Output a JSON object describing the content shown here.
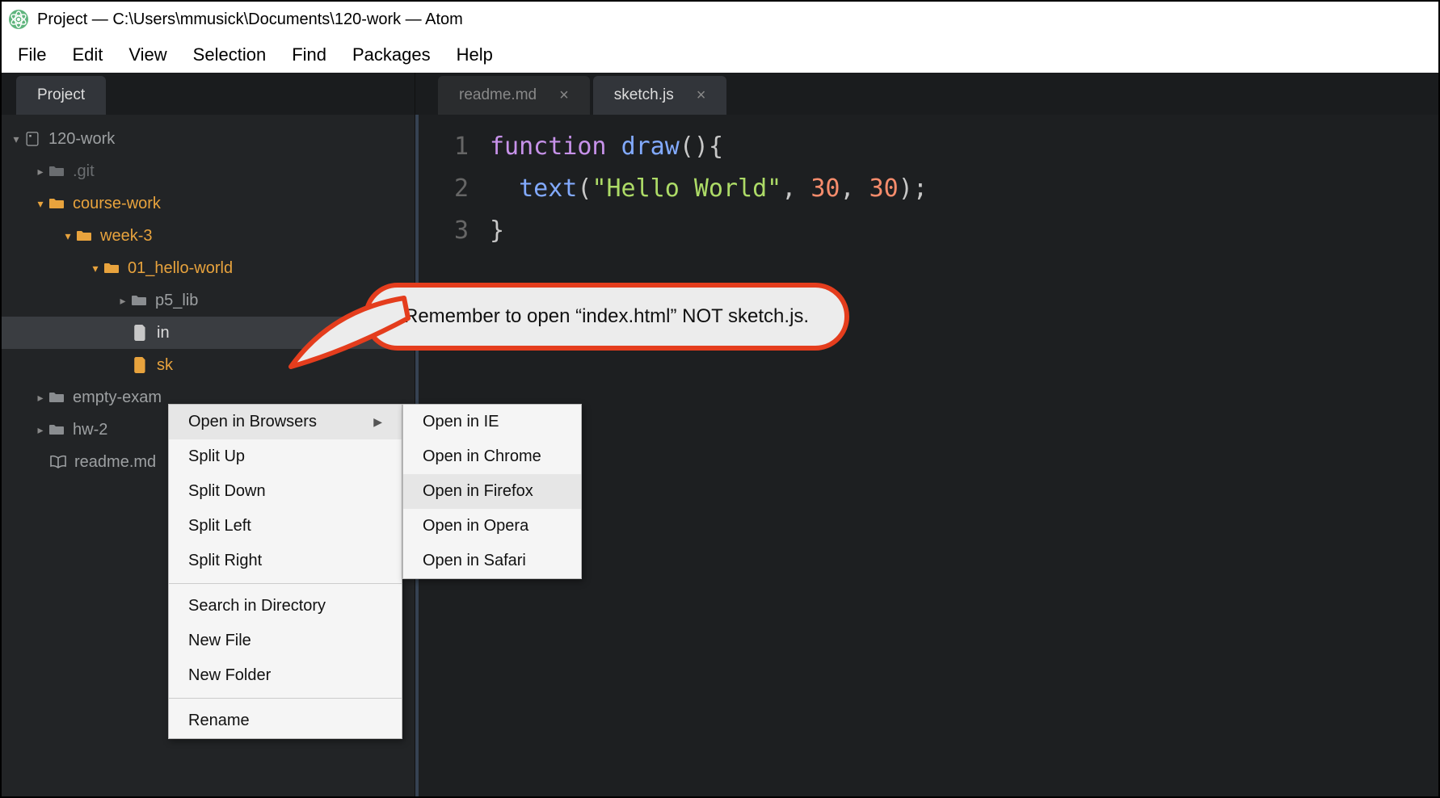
{
  "window": {
    "title": "Project — C:\\Users\\mmusick\\Documents\\120-work — Atom"
  },
  "menubar": [
    "File",
    "Edit",
    "View",
    "Selection",
    "Find",
    "Packages",
    "Help"
  ],
  "sidebar": {
    "tab": "Project",
    "tree": {
      "root": "120-work",
      "git": ".git",
      "coursework": "course-work",
      "week3": "week-3",
      "hello": "01_hello-world",
      "p5lib": "p5_lib",
      "index_partial": "in",
      "sketch_partial": "sk",
      "empty": "empty-exam",
      "hw2": "hw-2",
      "readme": "readme.md"
    }
  },
  "editor_tabs": [
    {
      "label": "readme.md",
      "active": false
    },
    {
      "label": "sketch.js",
      "active": true
    }
  ],
  "code": {
    "l1": "1",
    "l2": "2",
    "l3": "3",
    "kw_function": "function",
    "fn_draw": "draw",
    "fn_text": "text",
    "str_hello": "\"Hello World\"",
    "num_a": "30",
    "num_b": "30",
    "brace_close": "}"
  },
  "context_menu": {
    "items": [
      "Open in Browsers",
      "Split Up",
      "Split Down",
      "Split Left",
      "Split Right",
      "Search in Directory",
      "New File",
      "New Folder",
      "Rename"
    ],
    "submenu": [
      "Open in IE",
      "Open in Chrome",
      "Open in Firefox",
      "Open in Opera",
      "Open in Safari"
    ]
  },
  "callout": {
    "text": "Remember to open “index.html” NOT sketch.js."
  }
}
